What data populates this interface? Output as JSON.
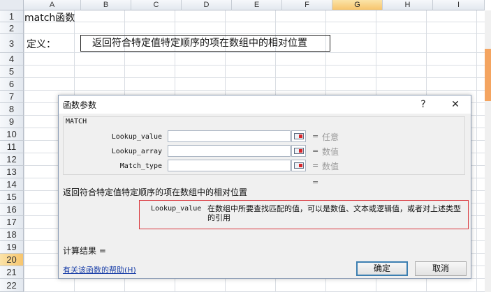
{
  "sheet": {
    "columns": [
      "A",
      "B",
      "C",
      "D",
      "E",
      "F",
      "G",
      "H",
      "I"
    ],
    "selected_column": "G",
    "rows": [
      "1",
      "2",
      "3",
      "4",
      "5",
      "6",
      "7",
      "8",
      "9",
      "10",
      "11",
      "12",
      "13",
      "14",
      "15",
      "16",
      "17",
      "18",
      "19",
      "20",
      "21",
      "22"
    ],
    "selected_row": "20",
    "a1": "match函数",
    "a3": "定义：",
    "b3": "返回符合特定值特定顺序的项在数组中的相对位置"
  },
  "dialog": {
    "title": "函数参数",
    "help_btn": "?",
    "close_btn": "✕",
    "function_name": "MATCH",
    "args": [
      {
        "label": "Lookup_value",
        "value": "",
        "equals": "=",
        "hint": "任意"
      },
      {
        "label": "Lookup_array",
        "value": "",
        "equals": "=",
        "hint": "数值"
      },
      {
        "label": "Match_type",
        "value": "",
        "equals": "=",
        "hint": "数值"
      }
    ],
    "result_equals": "=",
    "description": "返回符合特定值特定顺序的项在数组中的相对位置",
    "arg_help_name": "Lookup_value",
    "arg_help_text": "在数组中所要查找匹配的值，可以是数值、文本或逻辑值，或者对上述类型的引用",
    "calc_result": "计算结果 =",
    "help_link": "有关该函数的帮助(H)",
    "ok": "确定",
    "cancel": "取消"
  },
  "colors": {
    "accent": "#f7c56d",
    "red_outline": "#d9343a",
    "link": "#1a3fa8",
    "scroll_thumb": "#f4a460"
  }
}
